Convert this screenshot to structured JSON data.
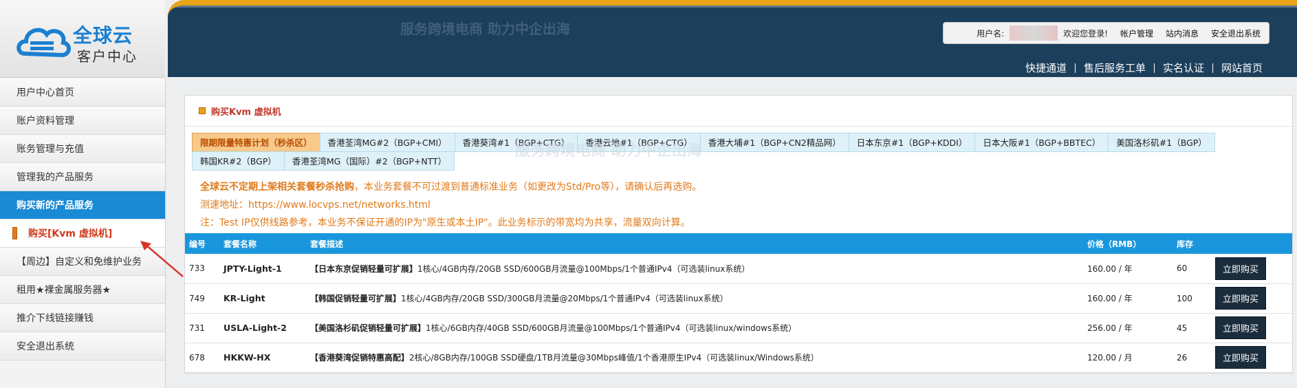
{
  "brand": {
    "name": "全球云",
    "subtitle": "客户中心"
  },
  "watermark": {
    "line": "服务跨境电商 助力中企出海"
  },
  "userbar": {
    "label": "用户名:",
    "welcome": "欢迎您登录!",
    "links": [
      "帐户管理",
      "站内消息",
      "安全退出系统"
    ]
  },
  "topnav": [
    "快捷通道",
    "售后服务工单",
    "实名认证",
    "网站首页"
  ],
  "sidebar": {
    "items": [
      {
        "label": "用户中心首页"
      },
      {
        "label": "账户资料管理"
      },
      {
        "label": "账务管理与充值"
      },
      {
        "label": "管理我的产品服务"
      },
      {
        "label": "购买新的产品服务"
      },
      {
        "label": "购买[Kvm 虚拟机]"
      },
      {
        "label": "【周边】自定义和免维护业务"
      },
      {
        "label": "租用★裸金属服务器★"
      },
      {
        "label": "推介下线链接赚钱"
      },
      {
        "label": "安全退出系统"
      }
    ]
  },
  "panel": {
    "title": "购买Kvm 虚拟机",
    "tabs": [
      "限期限量特惠计划（秒杀区）",
      "香港荃湾MG#2（BGP+CMI）",
      "香港葵湾#1（BGP+CTG）",
      "香港云地#1（BGP+CTG）",
      "香港大埔#1（BGP+CN2精品网）",
      "日本东京#1（BGP+KDDI）",
      "日本大阪#1（BGP+BBTEC）",
      "美国洛杉矶#1（BGP）",
      "韩国KR#2（BGP）",
      "香港荃湾MG（国际）#2（BGP+NTT）"
    ],
    "notes": {
      "line1_bold": "全球云不定期上架相关套餐秒杀抢购",
      "line1_rest": "，本业务套餐不可过渡到普通标准业务（如更改为Std/Pro等），请确认后再选购。",
      "line2": "测速地址：https://www.locvps.net/networks.html",
      "line3": "注：Test IP仅供线路参考，本业务不保证开通的IP为\"原生或本土IP\"。此业务标示的带宽均为共享，流量双向计算。"
    },
    "table": {
      "headers": [
        "编号",
        "套餐名称",
        "套餐描述",
        "价格（RMB）",
        "库存",
        ""
      ],
      "rows": [
        {
          "id": "733",
          "name": "JPTY-Light-1",
          "desc_bold": "【日本东京促销轻量可扩展】",
          "desc": "1核心/4GB内存/20GB SSD/600GB月流量@100Mbps/1个普通IPv4（可选装linux系统）",
          "price": "160.00 / 年",
          "stock": "60",
          "buy": "立即购买"
        },
        {
          "id": "749",
          "name": "KR-Light",
          "desc_bold": "【韩国促销轻量可扩展】",
          "desc": "1核心/4GB内存/20GB SSD/300GB月流量@20Mbps/1个普通IPv4（可选装linux系统）",
          "price": "160.00 / 年",
          "stock": "100",
          "buy": "立即购买"
        },
        {
          "id": "731",
          "name": "USLA-Light-2",
          "desc_bold": "【美国洛杉矶促销轻量可扩展】",
          "desc": "1核心/6GB内存/40GB SSD/600GB月流量@100Mbps/1个普通IPv4（可选装linux/windows系统）",
          "price": "256.00 / 年",
          "stock": "45",
          "buy": "立即购买"
        },
        {
          "id": "678",
          "name": "HKKW-HX",
          "desc_bold": "【香港葵湾促销特惠高配】",
          "desc": "2核心/8GB内存/100GB SSD硬盘/1TB月流量@30Mbps峰值/1个香港原生IPv4（可选装linux/Windows系统）",
          "price": "120.00 / 月",
          "stock": "26",
          "buy": "立即购买"
        }
      ]
    }
  }
}
